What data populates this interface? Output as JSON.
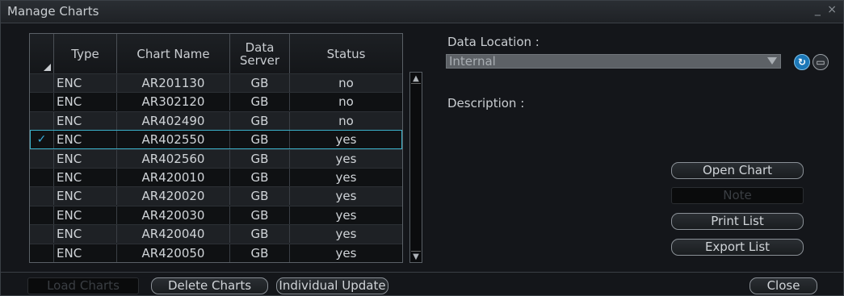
{
  "window": {
    "title": "Manage Charts",
    "controls": "_ ×"
  },
  "table": {
    "headers": {
      "type": "Type",
      "chart_name": "Chart Name",
      "data_server_line1": "Data",
      "data_server_line2": "Server",
      "status": "Status"
    },
    "rows": [
      {
        "check": "",
        "type": "ENC",
        "name": "AR201130",
        "server": "GB",
        "status": "no"
      },
      {
        "check": "",
        "type": "ENC",
        "name": "AR302120",
        "server": "GB",
        "status": "no"
      },
      {
        "check": "",
        "type": "ENC",
        "name": "AR402490",
        "server": "GB",
        "status": "no"
      },
      {
        "check": "✓",
        "type": "ENC",
        "name": "AR402550",
        "server": "GB",
        "status": "yes"
      },
      {
        "check": "",
        "type": "ENC",
        "name": "AR402560",
        "server": "GB",
        "status": "yes"
      },
      {
        "check": "",
        "type": "ENC",
        "name": "AR420010",
        "server": "GB",
        "status": "yes"
      },
      {
        "check": "",
        "type": "ENC",
        "name": "AR420020",
        "server": "GB",
        "status": "yes"
      },
      {
        "check": "",
        "type": "ENC",
        "name": "AR420030",
        "server": "GB",
        "status": "yes"
      },
      {
        "check": "",
        "type": "ENC",
        "name": "AR420040",
        "server": "GB",
        "status": "yes"
      },
      {
        "check": "",
        "type": "ENC",
        "name": "AR420050",
        "server": "GB",
        "status": "yes"
      }
    ],
    "selected_index": 3
  },
  "right_panel": {
    "data_location_label": "Data Location :",
    "data_location_value": "Internal",
    "description_label": "Description :",
    "buttons": {
      "open_chart": "Open Chart",
      "note": "Note",
      "print_list": "Print List",
      "export_list": "Export List"
    }
  },
  "footer": {
    "load_charts": "Load Charts",
    "delete_charts": "Delete Charts",
    "individual_update": "Individual Update",
    "close": "Close"
  },
  "icons": {
    "refresh": "refresh-icon",
    "folder": "folder-icon",
    "scroll_up": "scroll-up-icon",
    "scroll_down": "scroll-down-icon"
  },
  "colors": {
    "selection_outline": "#3ab0c8",
    "check": "#3ab0e0"
  }
}
